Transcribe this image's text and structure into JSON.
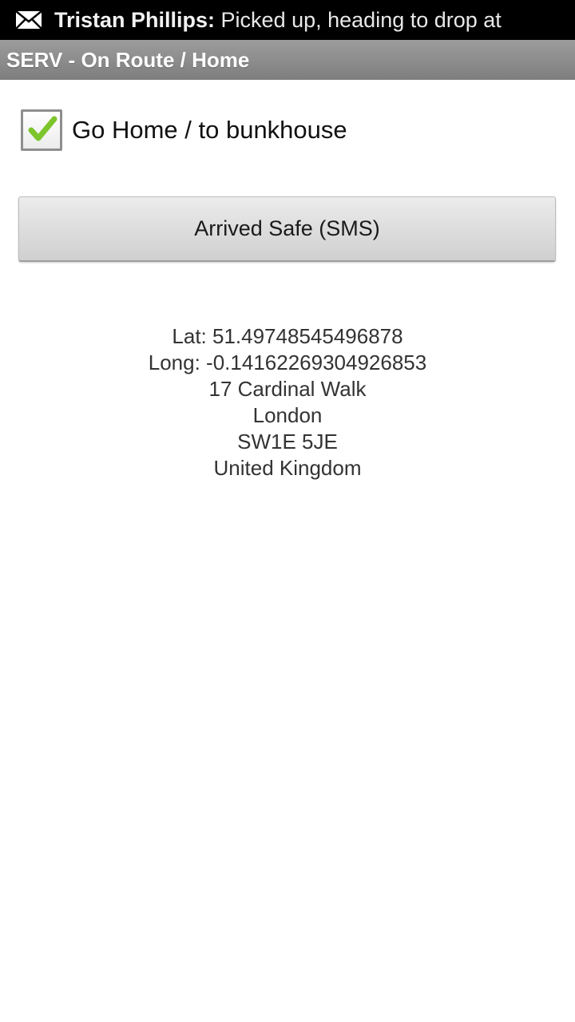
{
  "status_bar": {
    "icon": "envelope-icon",
    "sender": "Tristan Phillips:",
    "message": " Picked up, heading to drop at"
  },
  "title_bar": {
    "title": "SERV - On Route / Home"
  },
  "checkbox": {
    "label": "Go Home / to bunkhouse",
    "checked": true,
    "check_color": "#7dc52c"
  },
  "arrived_button": {
    "label": "Arrived Safe (SMS)"
  },
  "location": {
    "lat": "Lat: 51.49748545496878",
    "long": "Long: -0.14162269304926853",
    "street": "17 Cardinal Walk",
    "city": "London",
    "postcode": "SW1E 5JE",
    "country": "United Kingdom"
  }
}
